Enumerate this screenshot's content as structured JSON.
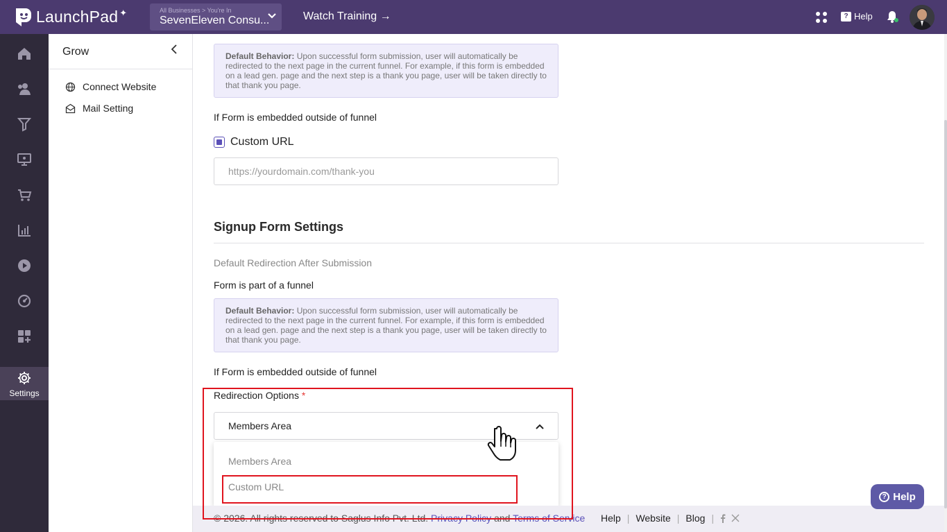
{
  "app": {
    "name": "LaunchPad"
  },
  "business_switcher": {
    "caption": "All Businesses > You're In",
    "name": "SevenEleven Consu..."
  },
  "header": {
    "watch_training": "Watch Training →",
    "help": "Help"
  },
  "leftnav": {
    "items": [
      "home-icon",
      "contacts-icon",
      "funnel-icon",
      "courses-icon",
      "store-icon",
      "analytics-icon",
      "video-icon",
      "dashboard-icon",
      "apps-icon"
    ],
    "settings_label": "Settings"
  },
  "grow_panel": {
    "title": "Grow",
    "items": [
      {
        "label": "Connect Website",
        "icon": "globe-icon"
      },
      {
        "label": "Mail Setting",
        "icon": "mail-icon"
      }
    ]
  },
  "form_section_top": {
    "default_behavior_label": "Default Behavior:",
    "default_behavior_text": " Upon successful form submission, user will automatically be redirected to the next page in the current funnel. For example, if this form is embedded on a lead gen. page and the next step is a thank you page, user will be taken directly to that thank you page.",
    "embedded_outside_label": "If Form is embedded outside of funnel",
    "custom_url_label": "Custom URL",
    "custom_url_placeholder": "https://yourdomain.com/thank-you"
  },
  "signup_section": {
    "title": "Signup Form Settings",
    "default_redirection_label": "Default Redirection After Submission",
    "part_of_funnel_label": "Form is part of a funnel",
    "default_behavior_label": "Default Behavior:",
    "default_behavior_text": " Upon successful form submission, user will automatically be redirected to the next page in the current funnel. For example, if this form is embedded on a lead gen. page and the next step is a thank you page, user will be taken directly to that thank you page.",
    "embedded_outside_label": "If Form is embedded outside of funnel",
    "redirection_options_label": "Redirection Options",
    "required_mark": "*",
    "selected_option": "Members Area",
    "options": [
      "Members Area",
      "Custom URL"
    ]
  },
  "footer": {
    "copyright": "©  2026. All rights reserved to Saglus Info Pvt. Ltd.",
    "privacy": "Privacy Policy",
    "and": " and ",
    "terms": "Terms of Service",
    "links": [
      "Help",
      "Website",
      "Blog"
    ]
  },
  "help_fab": {
    "label": "Help"
  },
  "colors": {
    "topbar": "#4b3a6f",
    "sidebar": "#2f2a3a",
    "accent": "#5b50b8",
    "highlight": "#e0141e"
  }
}
